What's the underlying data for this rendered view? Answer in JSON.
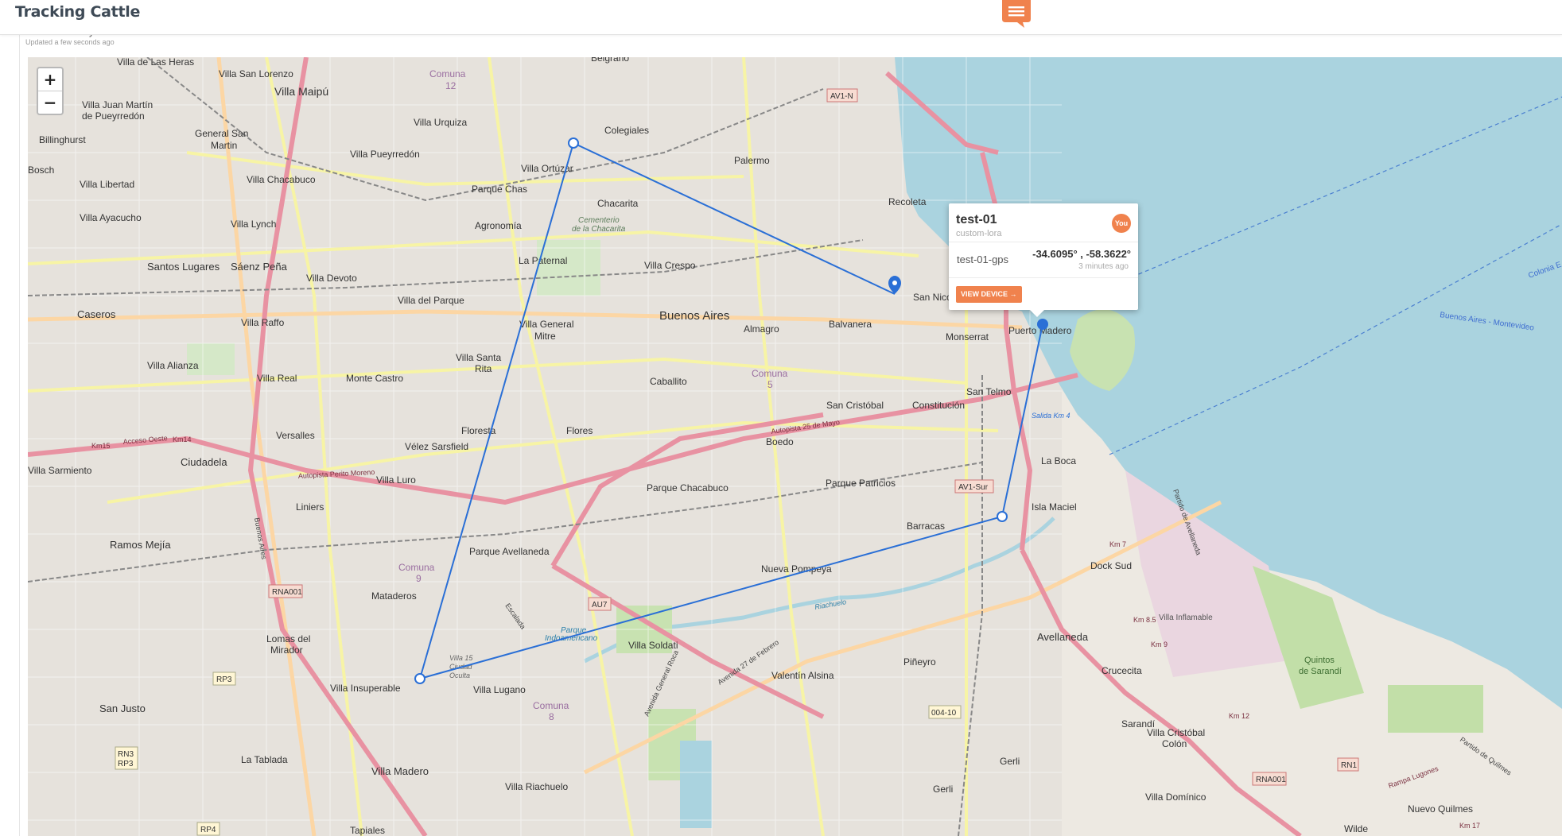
{
  "app": {
    "title": "Tracking Cattle"
  },
  "card": {
    "title": "Location History",
    "subtitle": "Updated a few seconds ago"
  },
  "map_controls": {
    "zoom_in": "+",
    "zoom_out": "−"
  },
  "popup": {
    "device_name": "test-01",
    "device_type": "custom-lora",
    "badge": "You",
    "sensor": "test-01-gps",
    "coordinates": "-34.6095° , -58.3622°",
    "updated": "3 minutes ago",
    "button": "VIEW DEVICE →"
  },
  "colors": {
    "accent": "#f0824d",
    "track": "#2a6fd6",
    "water": "#aad3df",
    "motorway": "#e892a2"
  },
  "icons": {
    "chat": "chat-icon",
    "marker": "map-pin-icon"
  },
  "map_labels": {
    "belgrano": "Belgrano",
    "villa_las_heras": "Villa de Las Heras",
    "villa_san_lorenzo": "Villa San Lorenzo",
    "comuna12": "Comuna",
    "comuna12n": "12",
    "villa_maipu": "Villa Maipú",
    "villa_juan_martin": "Villa Juan Martín",
    "de_pueyrredon": "de Pueyrredón",
    "billinghurst": "Billinghurst",
    "general_san": "General San",
    "martin": "Martin",
    "villa_urquiza": "Villa Urquiza",
    "colegiales": "Colegiales",
    "palermo": "Palermo",
    "villa_pueyrredon": "Villa Pueyrredón",
    "bosch": "Bosch",
    "villa_libertad": "Villa Libertad",
    "villa_chacabuco": "Villa Chacabuco",
    "villa_ortuzar": "Villa Ortúzar",
    "parque_chas": "Parque Chas",
    "chacarita": "Chacarita",
    "recoleta": "Recoleta",
    "villa_ayacucho": "Villa Ayacucho",
    "cementerio": "Cementerio",
    "de_la_chacarita": "de la Chacarita",
    "agronomia": "Agronomía",
    "villa_lynch": "Villa Lynch",
    "santos_lugares": "Santos Lugares",
    "saenz_pena": "Sáenz Peña",
    "villa_devoto": "Villa Devoto",
    "la_paternal": "La Paternal",
    "villa_crespo": "Villa Crespo",
    "san_nicolas": "San Nicolás",
    "caseros": "Caseros",
    "villa_del_parque": "Villa del Parque",
    "buenos_aires": "Buenos Aires",
    "balvanera": "Balvanera",
    "villa_raffo": "Villa Raffo",
    "villa_general": "Villa General",
    "mitre": "Mitre",
    "almagro": "Almagro",
    "monserrat": "Monserrat",
    "puerto_madero": "Puerto Madero",
    "villa_santa": "Villa Santa",
    "rita": "Rita",
    "villa_alianza": "Villa Alianza",
    "caballito": "Caballito",
    "comuna5": "Comuna",
    "comuna5n": "5",
    "villa_real": "Villa Real",
    "monte_castro": "Monte Castro",
    "san_telmo": "San Telmo",
    "san_cristobal": "San Cristóbal",
    "constitucion": "Constitución",
    "versalles": "Versalles",
    "floresta": "Floresta",
    "flores": "Flores",
    "boedo": "Boedo",
    "velez": "Vélez Sarsfield",
    "villa_sarmiento": "Villa Sarmiento",
    "ciudadela": "Ciudadela",
    "villa_luro": "Villa Luro",
    "la_boca": "La Boca",
    "parque_chacabuco": "Parque Chacabuco",
    "parque_patricios": "Parque Patricios",
    "liniers": "Liniers",
    "isla_maciel": "Isla Maciel",
    "barracas": "Barracas",
    "ramos_mejia": "Ramos Mejía",
    "parque_avellaneda": "Parque Avellaneda",
    "dock_sud": "Dock Sud",
    "nueva_pompeya": "Nueva Pompeya",
    "comuna9": "Comuna",
    "comuna9n": "9",
    "mataderos": "Mataderos",
    "lomas_del": "Lomas del",
    "mirador": "Mirador",
    "parque": "Parque",
    "indoamericano": "Indoamericano",
    "villa_soldati": "Villa Soldati",
    "avellaneda": "Avellaneda",
    "villa_15": "Villa 15",
    "ciudad": "Ciudad",
    "oculta": "Oculta",
    "pineyro": "Piñeyro",
    "crucecita": "Crucecita",
    "valentin_alsina": "Valentín Alsina",
    "san_justo": "San Justo",
    "villa_insuperable": "Villa Insuperable",
    "villa_lugano": "Villa Lugano",
    "comuna8": "Comuna",
    "comuna8n": "8",
    "quintos": "Quintos",
    "de_sarandi": "de Sarandí",
    "sarandi": "Sarandí",
    "villa_cristobal": "Villa Cristóbal",
    "colon": "Colón",
    "la_tablada": "La Tablada",
    "villa_madero": "Villa Madero",
    "villa_riachuelo": "Villa Riachuelo",
    "gerli": "Gerli",
    "villa_dominico": "Villa Domínico",
    "nuevo_quilmes": "Nuevo Quilmes",
    "tapiales": "Tapiales",
    "wilde": "Wilde",
    "villa_inflamable": "Villa Inflamable",
    "buenos_aires_montevideo": "Buenos Aires - Montevideo",
    "colonia": "Colonia E",
    "shield_av1n": "AV1-N",
    "shield_av1sur": "AV1-Sur",
    "shield_rna001a": "RNA001",
    "shield_rna001b": "RNA001",
    "shield_au7": "AU7",
    "shield_rp3": "RP3",
    "shield_rn3": "RN3",
    "shield_rp3b": "RP3",
    "shield_0410": "004-10",
    "shield_rp4": "RP4",
    "shield_rn1": "RN1",
    "acceso_oeste": "Acceso Oeste",
    "km15": "Km15",
    "km14": "Km14",
    "autopista_perito": "Autopista Perito Moreno",
    "autopista_25": "Autopista 25 de Mayo",
    "salida_km4": "Salida Km 4",
    "riachuelo": "Riachuelo",
    "av_escalada": "Escalada",
    "av_27_febrero": "Avenida 27 de Febrero",
    "av_roca": "Avenida General Roca",
    "buenos_aires_road": "Buenos Aires",
    "partido_avellaneda": "Partido de Avellaneda",
    "km12": "Km 12",
    "km85": "Km 8.5",
    "km9": "Km 9",
    "km7": "Km 7",
    "km17": "Km 17",
    "rampa_lugones": "Rampa Lugones",
    "partido_quilmes": "Partido de Quilmes"
  }
}
